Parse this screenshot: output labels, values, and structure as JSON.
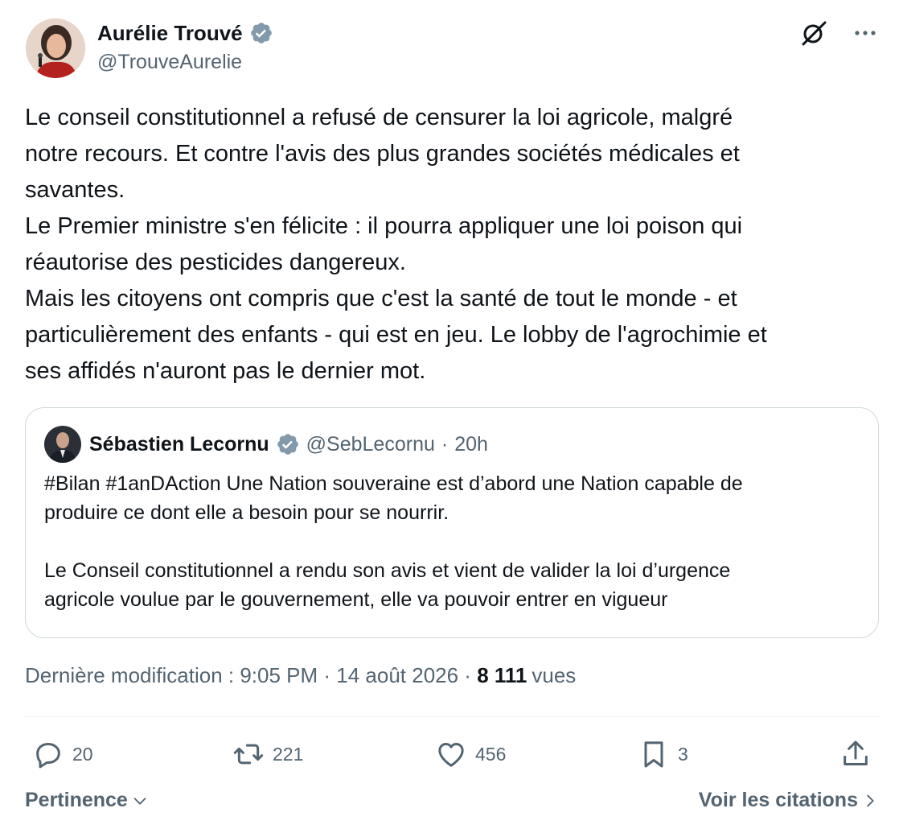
{
  "author": {
    "name": "Aurélie Trouvé",
    "handle": "@TrouveAurelie"
  },
  "tweet": {
    "lines": [
      "Le conseil constitutionnel a refusé de censurer la loi agricole, malgré",
      "notre recours. Et contre l'avis des plus grandes sociétés médicales et",
      "savantes.",
      "Le Premier ministre s'en félicite : il pourra appliquer une loi poison qui",
      "réautorise des pesticides dangereux.",
      "Mais les citoyens ont compris que c'est la santé de tout le monde - et",
      "particulièrement des enfants - qui est en jeu. Le lobby de l'agrochimie et",
      "ses affidés n'auront pas le dernier mot."
    ]
  },
  "quote": {
    "name": "Sébastien Lecornu",
    "handle": "@SebLecornu",
    "separator": "·",
    "time": "20h",
    "para1": [
      "#Bilan #1anDAction Une Nation souveraine est d’abord une Nation capable de",
      "produire ce dont elle a besoin pour se nourrir."
    ],
    "para2": [
      "Le Conseil constitutionnel a rendu son avis et vient de valider la loi d’urgence",
      "agricole voulue par le gouvernement, elle va pouvoir entrer en vigueur"
    ]
  },
  "meta": {
    "edited": "Dernière modification : 9:05 PM · 14 août 2026 · ",
    "views_count": "8 111",
    "views_label": "vues"
  },
  "actions": {
    "replies": "20",
    "reposts": "221",
    "likes": "456",
    "bookmarks": "3"
  },
  "footer": {
    "sort_label": "Pertinence",
    "quotes_link": "Voir les citations"
  },
  "colors": {
    "text": "#0f1419",
    "secondary": "#536471",
    "verified": "#829aab",
    "border": "#cfd9de"
  },
  "icons": [
    "verified-icon",
    "grok-icon",
    "more-icon",
    "reply-icon",
    "repost-icon",
    "like-icon",
    "bookmark-icon",
    "share-icon",
    "chevron-down-icon",
    "chevron-right-icon"
  ]
}
